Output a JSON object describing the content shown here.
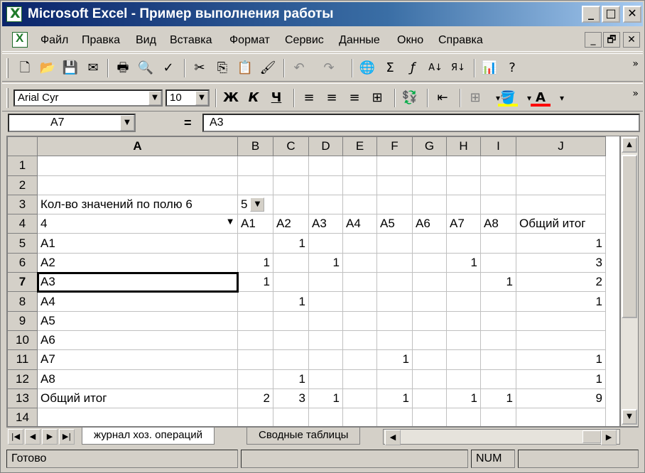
{
  "window": {
    "title": "Microsoft Excel - Пример выполнения работы",
    "controls": [
      "_",
      "□",
      "✕"
    ]
  },
  "menu": {
    "items": [
      "Файл",
      "Правка",
      "Вид",
      "Вставка",
      "Формат",
      "Сервис",
      "Данные",
      "Окно",
      "Справка"
    ],
    "doc_controls": [
      "_",
      "🗗",
      "✕"
    ]
  },
  "toolbar_standard": {
    "buttons": [
      "new-icon",
      "open-icon",
      "save-icon",
      "mail-icon",
      "print-icon",
      "print-preview-icon",
      "spelling-icon",
      "cut-icon",
      "copy-icon",
      "paste-icon",
      "format-painter-icon",
      "undo-icon",
      "redo-icon",
      "hyperlink-icon",
      "autosum-icon",
      "function-icon",
      "sort-ascending-icon",
      "sort-descending-icon",
      "chart-wizard-icon",
      "help-icon"
    ]
  },
  "toolbar_format": {
    "font": "Arial Cyr",
    "size": "10",
    "bold": "Ж",
    "italic": "К",
    "underline": "Ч",
    "fill_color": "#ffff00",
    "font_color": "#ff0000"
  },
  "formula_bar": {
    "name_box": "A7",
    "equals": "=",
    "content": "A3"
  },
  "grid": {
    "columns": [
      "A",
      "B",
      "C",
      "D",
      "E",
      "F",
      "G",
      "H",
      "I",
      "J"
    ],
    "rows": [
      {
        "n": "1",
        "cells": [
          "",
          "",
          "",
          "",
          "",
          "",
          "",
          "",
          "",
          ""
        ]
      },
      {
        "n": "2",
        "cells": [
          "",
          "",
          "",
          "",
          "",
          "",
          "",
          "",
          "",
          ""
        ]
      },
      {
        "n": "3",
        "cells": [
          "Кол-во значений по полю 6",
          "5",
          "",
          "",
          "",
          "",
          "",
          "",
          "",
          ""
        ]
      },
      {
        "n": "4",
        "cells": [
          "4",
          "A1",
          "A2",
          "A3",
          "A4",
          "A5",
          "A6",
          "A7",
          "A8",
          "Общий итог"
        ]
      },
      {
        "n": "5",
        "cells": [
          "A1",
          "",
          "1",
          "",
          "",
          "",
          "",
          "",
          "",
          "1"
        ]
      },
      {
        "n": "6",
        "cells": [
          "A2",
          "1",
          "",
          "1",
          "",
          "",
          "",
          "1",
          "",
          "3"
        ]
      },
      {
        "n": "7",
        "cells": [
          "A3",
          "1",
          "",
          "",
          "",
          "",
          "",
          "",
          "1",
          "2"
        ]
      },
      {
        "n": "8",
        "cells": [
          "A4",
          "",
          "1",
          "",
          "",
          "",
          "",
          "",
          "",
          "1"
        ]
      },
      {
        "n": "9",
        "cells": [
          "A5",
          "",
          "",
          "",
          "",
          "",
          "",
          "",
          "",
          ""
        ]
      },
      {
        "n": "10",
        "cells": [
          "A6",
          "",
          "",
          "",
          "",
          "",
          "",
          "",
          "",
          ""
        ]
      },
      {
        "n": "11",
        "cells": [
          "A7",
          "",
          "",
          "",
          "",
          "1",
          "",
          "",
          "",
          "1"
        ]
      },
      {
        "n": "12",
        "cells": [
          "A8",
          "",
          "1",
          "",
          "",
          "",
          "",
          "",
          "",
          "1"
        ]
      },
      {
        "n": "13",
        "cells": [
          "Общий итог",
          "2",
          "3",
          "1",
          "",
          "1",
          "",
          "1",
          "1",
          "9"
        ]
      },
      {
        "n": "14",
        "cells": [
          "",
          "",
          "",
          "",
          "",
          "",
          "",
          "",
          "",
          ""
        ]
      }
    ],
    "selected_cell": "A7"
  },
  "sheets": {
    "tabs": [
      "журнал хоз. операций",
      "Сводные таблицы"
    ],
    "active": 0
  },
  "status": {
    "ready": "Готово",
    "num": "NUM"
  }
}
